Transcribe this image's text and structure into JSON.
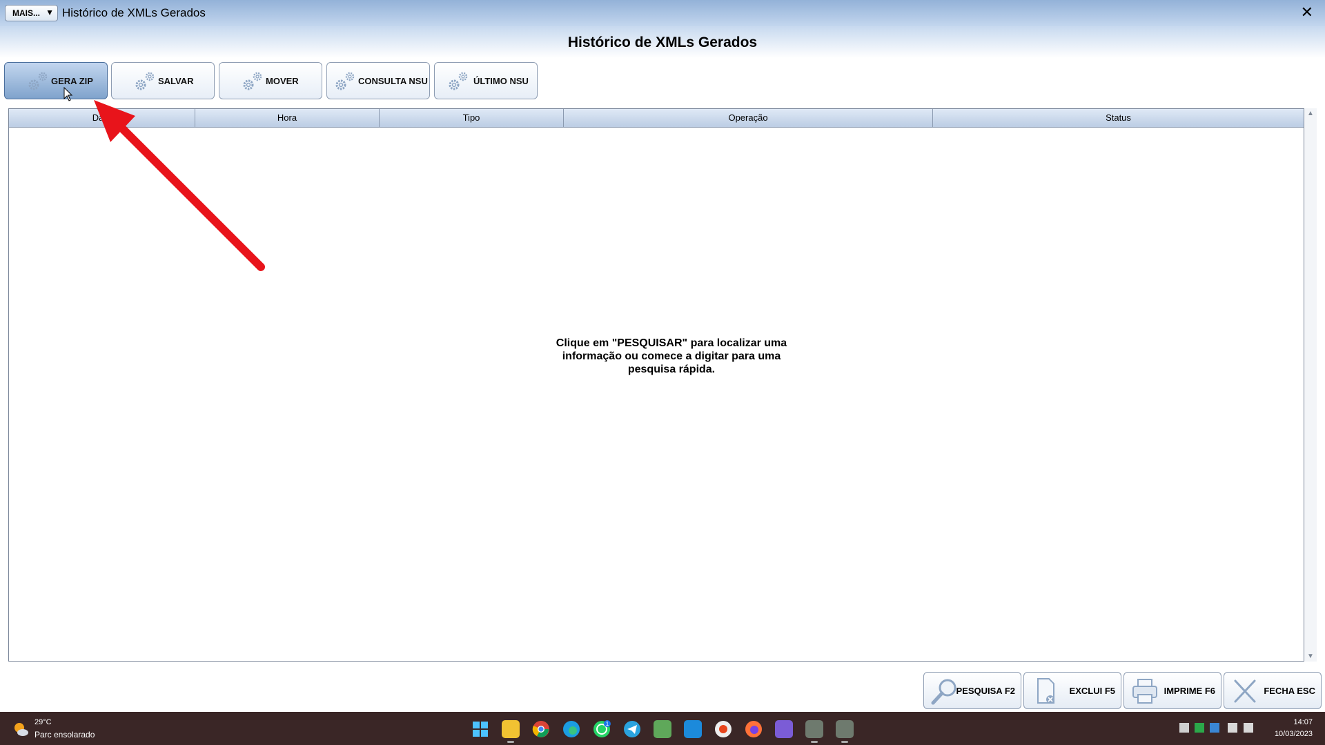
{
  "window": {
    "mais_label": "MAIS...",
    "title": "Histórico de XMLs Gerados",
    "close_glyph": "✕",
    "heading": "Histórico de XMLs Gerados"
  },
  "toolbar": {
    "buttons": [
      {
        "label": "GERA ZIP",
        "icon": "gear-icon",
        "active": true
      },
      {
        "label": "SALVAR",
        "icon": "gear-icon",
        "active": false
      },
      {
        "label": "MOVER",
        "icon": "gear-icon",
        "active": false
      },
      {
        "label": "CONSULTA NSU",
        "icon": "gear-icon",
        "active": false
      },
      {
        "label": "ÚLTIMO NSU",
        "icon": "gear-icon",
        "active": false
      }
    ]
  },
  "grid": {
    "columns": [
      "Data",
      "Hora",
      "Tipo",
      "Operação",
      "Status"
    ],
    "rows": [],
    "empty_message": "Clique em \"PESQUISAR\" para localizar uma informação ou comece a digitar para uma pesquisa rápida."
  },
  "actions": {
    "pesquisa": "PESQUISA F2",
    "exclui": "EXCLUI F5",
    "imprime": "IMPRIME F6",
    "fecha": "FECHA ESC"
  },
  "annotation": {
    "color": "#e8141b"
  },
  "taskbar": {
    "weather_temp": "29°C",
    "weather_desc": "Parc ensolarado",
    "whatsapp_badge": "1",
    "time": "14:07",
    "date": "10/03/2023",
    "apps": [
      "windows-start-icon",
      "file-explorer-icon",
      "chrome-icon",
      "edge-icon",
      "whatsapp-icon",
      "telegram-icon",
      "notepad-icon",
      "remote-app-icon",
      "app-icon",
      "firefox-icon",
      "video-editor-icon",
      "system-app-icon",
      "system-app-icon-2"
    ]
  },
  "colors": {
    "titlebar": "#93b2d8",
    "accent": "#4b6f9d",
    "taskbar": "#3a2626"
  }
}
